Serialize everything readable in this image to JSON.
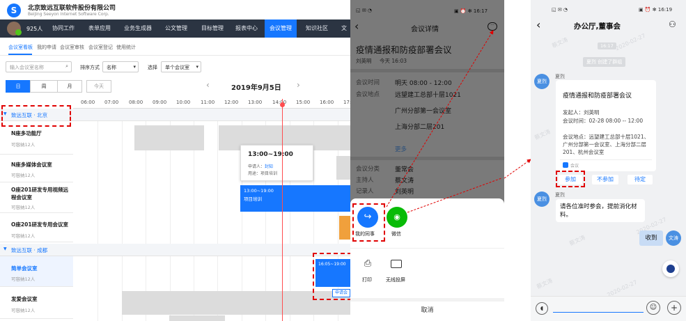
{
  "oa": {
    "company_cn": "北京致远互联软件股份有限公司",
    "company_en": "BeiJing Seeyon Internet Software Corp.",
    "user_count": "925人",
    "nav": [
      "协同工作",
      "表单应用",
      "业务生成器",
      "公文管理",
      "目标管理",
      "报表中心",
      "会议管理",
      "知识社区",
      "文"
    ],
    "subnav": [
      "会议室看板",
      "我的申请",
      "会议室审核",
      "会议室登记",
      "使用统计"
    ],
    "search_placeholder": "输入会议室名称",
    "sort_label": "排序方式",
    "sort_value": "名称",
    "select_label": "选择",
    "select_value": "单个会议室",
    "view_day": "日",
    "view_week": "周",
    "view_month": "月",
    "today_btn": "今天",
    "prev": "‹",
    "next": "›",
    "date": "2019年9月5日",
    "times": [
      "06:00",
      "07:00",
      "08:00",
      "09:00",
      "10:00",
      "11:00",
      "12:00",
      "13:00",
      "14:00",
      "15:00",
      "16:00",
      "17:00"
    ],
    "group1": "致远互联 · 北京",
    "group2": "致远互联 · 成都",
    "rooms1": [
      {
        "name": "N座多功能厅",
        "cap": "可容纳12人"
      },
      {
        "name": "N座多媒体会议室",
        "cap": "可容纳12人"
      },
      {
        "name": "O座201研发专用视频远程会议室",
        "cap": "可容纳12人"
      },
      {
        "name": "O座201研发专用会议室",
        "cap": "可容纳12人"
      }
    ],
    "rooms2": [
      {
        "name": "简单会议室",
        "cap": "可容纳12人"
      },
      {
        "name": "发爱会议室",
        "cap": "可容纳12人"
      }
    ],
    "popup_time": "13:00~19:00",
    "popup_applicant_label": "申请人：",
    "popup_applicant": "封知",
    "popup_purpose": "用途：项目培训",
    "event1_time": "13:00~19:00",
    "event1_title": "项目培训",
    "event2_time": "16:05~19:00",
    "event2_tag": "申请会"
  },
  "detail": {
    "status_icons": "◱ ✉ ◔",
    "status_right": "▣ ⏰ ✻ 16:17",
    "title": "会议详情",
    "meeting_title": "疫情通报和防疫部署会议",
    "author": "刘英明",
    "post_time": "今天 16:03",
    "time_label": "会议时间",
    "time_value": "明天 08:00 - 12:00",
    "place_label": "会议地点",
    "places": [
      "远望建工总部十层1021",
      "广州分部第一会议室",
      "上海分部二层201"
    ],
    "more": "更多",
    "category_label": "会议分类",
    "category_value": "董常会",
    "host_label": "主持人",
    "host_value": "蔡文涛",
    "recorder_label": "记录人",
    "recorder_value": "刘英明",
    "share1": "我的同事",
    "share2": "微信",
    "share3": "打印",
    "share4": "无线投屏",
    "cancel": "取消"
  },
  "chat": {
    "status_icons": "◱ ✉ ◔",
    "status_right": "▣ ⏰ ✻ 16:19",
    "title": "办公厅,董事会",
    "time_stamp": "16:17",
    "system_msg": "夏烈 创建了群组",
    "sender": "夏烈",
    "avatar_label": "夏烈",
    "card_title": "疫情通报和防疫部署会议",
    "card_initiator": "发起人：刘英明",
    "card_time": "会议时间：02-28 08:00 -- 12:00",
    "card_place": "会议地点：远望建工总部十层1021、广州分部第一会议室、上海分部二层201、杭州会议室",
    "card_source": "会议",
    "join": "参加",
    "decline": "不参加",
    "pending": "待定",
    "sender2": "夏烈",
    "message": "请各位准时参会，提前消化材料。",
    "reply": "收到",
    "my_avatar": "文涛",
    "watermarks": [
      "蔡文涛",
      "2020-02-27",
      "蔡文涛",
      "2020-02-27",
      "蔡文涛",
      "2020-02-27",
      "蔡文涛",
      "2020-02-27"
    ]
  },
  "colors": {
    "accent": "#1677ff",
    "dash": "#e00000",
    "nav_bg": "#2b3442",
    "wechat": "#09bb07"
  }
}
